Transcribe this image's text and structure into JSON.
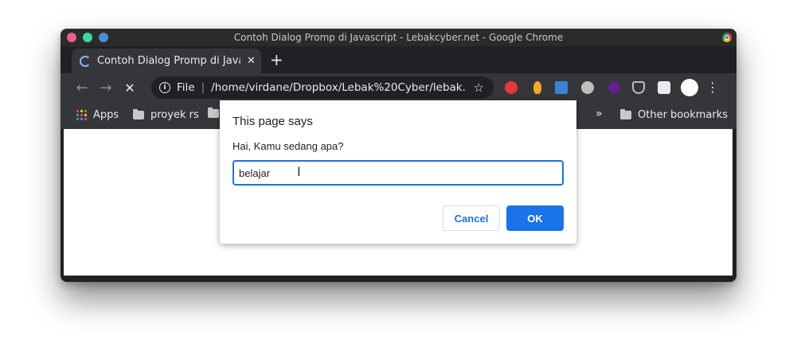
{
  "window": {
    "title": "Contoh Dialog Promp di Javascript - Lebakcyber.net - Google Chrome"
  },
  "tab": {
    "title": "Contoh Dialog Promp di Javascript",
    "close_icon": "close-icon",
    "new_tab": "+"
  },
  "toolbar": {
    "back": "←",
    "forward": "→",
    "stop": "✕",
    "info_icon": "i",
    "file_label": "File",
    "separator": "|",
    "url": "/home/virdane/Dropbox/Lebak%20Cyber/lebak...",
    "star": "☆",
    "menu": "⋮",
    "extensions": [
      "stop-extension-icon",
      "bulb-extension-icon",
      "note-extension-icon",
      "disk-extension-icon",
      "diamond-extension-icon",
      "pocket-icon",
      "puzzle-icon",
      "profile-avatar"
    ]
  },
  "bookmarks": {
    "apps_label": "Apps",
    "items": [
      "proyek rs"
    ],
    "overflow": "»",
    "other_label": "Other bookmarks"
  },
  "dialog": {
    "title": "This page says",
    "message": "Hai, Kamu sedang apa?",
    "input_value": "belajar",
    "cancel_label": "Cancel",
    "ok_label": "OK"
  },
  "colors": {
    "accent": "#1a73e8",
    "frame": "#202124",
    "toolbar": "#35363a"
  }
}
